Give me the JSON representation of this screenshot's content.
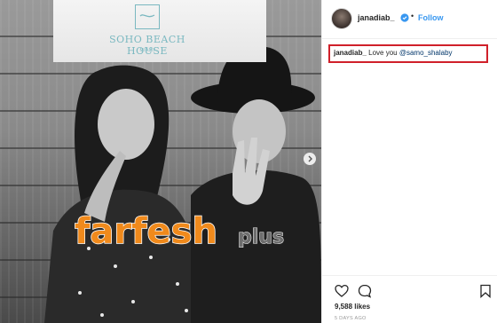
{
  "post": {
    "photo_brand": "SOHO BEACH HOUSE",
    "photo_brand_sub": "MIAMI",
    "watermark_text": "farfeshplus.com"
  },
  "header": {
    "username": "janadiab_",
    "separator": "•",
    "follow_label": "Follow"
  },
  "caption": {
    "username": "janadiab_",
    "text": "Love you",
    "mention": "@samo_shalaby"
  },
  "actions": {
    "likes": "9,588 likes",
    "timestamp": "5 DAYS AGO"
  },
  "colors": {
    "accent": "#3897f0",
    "highlight": "#d0202a",
    "watermark_orange": "#f08a1c",
    "watermark_gray": "#6e6e6e"
  },
  "icons": [
    "verified-badge-icon",
    "heart-icon",
    "comment-icon",
    "bookmark-icon",
    "chevron-right-icon"
  ]
}
